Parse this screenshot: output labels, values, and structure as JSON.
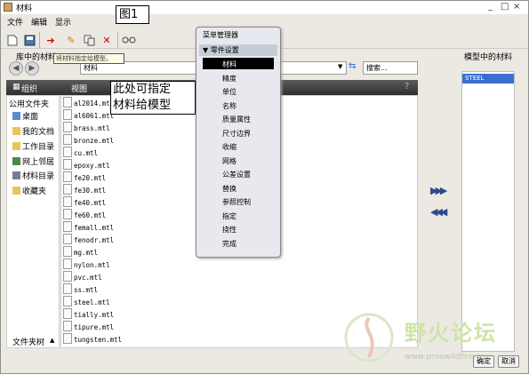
{
  "window": {
    "title": "材料",
    "min": "_",
    "max": "□",
    "close": "×"
  },
  "menu": [
    "文件",
    "编辑",
    "显示"
  ],
  "toolbar_label": "图1",
  "library": {
    "title": "库中的材料",
    "tooltip": "将材料指定给模型。",
    "path_label": "材料",
    "search_placeholder": "搜索...",
    "organize": "组织",
    "view": "视图"
  },
  "sidebar": {
    "items": [
      "公用文件夹",
      "桌面",
      "我的文档",
      "工作目录",
      "网上邻居",
      "材料目录",
      "收藏夹"
    ],
    "footer": "文件夹树"
  },
  "files": [
    "al2014.mtl",
    "al6061.mtl",
    "brass.mtl",
    "bronze.mtl",
    "cu.mtl",
    "epoxy.mtl",
    "fe20.mtl",
    "fe30.mtl",
    "fe40.mtl",
    "fe60.mtl",
    "femall.mtl",
    "fenodr.mtl",
    "mg.mtl",
    "nylon.mtl",
    "pvc.mtl",
    "ss.mtl",
    "steel.mtl",
    "tially.mtl",
    "tipure.mtl",
    "tungsten.mtl"
  ],
  "annotation": {
    "line1": "此处可指定",
    "line2": "材料给模型"
  },
  "popup": {
    "title": "菜单管理器",
    "header": "零件设置",
    "items": [
      "材料",
      "精度",
      "单位",
      "名称",
      "质量属性",
      "尺寸边界",
      "收缩",
      "网格",
      "公差设置",
      "替换",
      "参照控制",
      "指定",
      "挠性",
      "完成"
    ],
    "selected": "材料"
  },
  "model": {
    "title": "模型中的材料",
    "items": [
      "STEEL"
    ]
  },
  "buttons": {
    "ok": "确定",
    "cancel": "取消"
  },
  "watermark": {
    "text": "野火论坛",
    "url": "www.proewildfire.cn"
  }
}
